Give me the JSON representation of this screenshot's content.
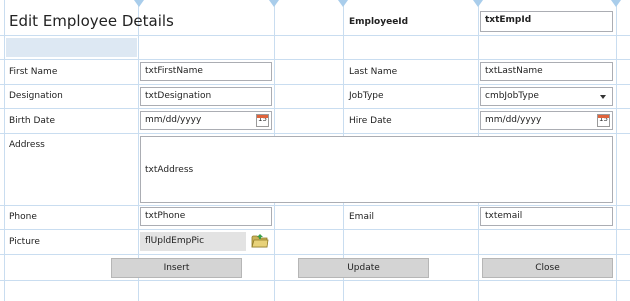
{
  "header": {
    "title": "Edit Employee Details",
    "employee_id_label": "EmployeeId",
    "employee_id_value": "txtEmpId"
  },
  "form": {
    "first_name": {
      "label": "First Name",
      "value": "txtFirstName"
    },
    "last_name": {
      "label": "Last Name",
      "value": "txtLastName"
    },
    "designation": {
      "label": "Designation",
      "value": "txtDesignation"
    },
    "job_type": {
      "label": "JobType",
      "value": "cmbJobType"
    },
    "birth_date": {
      "label": "Birth Date",
      "placeholder": "mm/dd/yyyy",
      "cal": "15"
    },
    "hire_date": {
      "label": "Hire Date",
      "placeholder": "mm/dd/yyyy",
      "cal": "15"
    },
    "address": {
      "label": "Address",
      "value": "txtAddress"
    },
    "phone": {
      "label": "Phone",
      "value": "txtPhone"
    },
    "email": {
      "label": "Email",
      "value": "txtemail"
    },
    "picture": {
      "label": "Picture",
      "value": "flUpldEmpPic"
    }
  },
  "buttons": {
    "insert": "Insert",
    "update": "Update",
    "close": "Close"
  },
  "icons": {
    "calendar": "calendar-icon",
    "folder": "folder-icon",
    "dropdown": "chevron-down-icon"
  },
  "colors": {
    "grid": "#c9ddf0",
    "marker": "#a9cdeb",
    "button": "#d4d4d4",
    "calendar_accent": "#e0643c"
  }
}
